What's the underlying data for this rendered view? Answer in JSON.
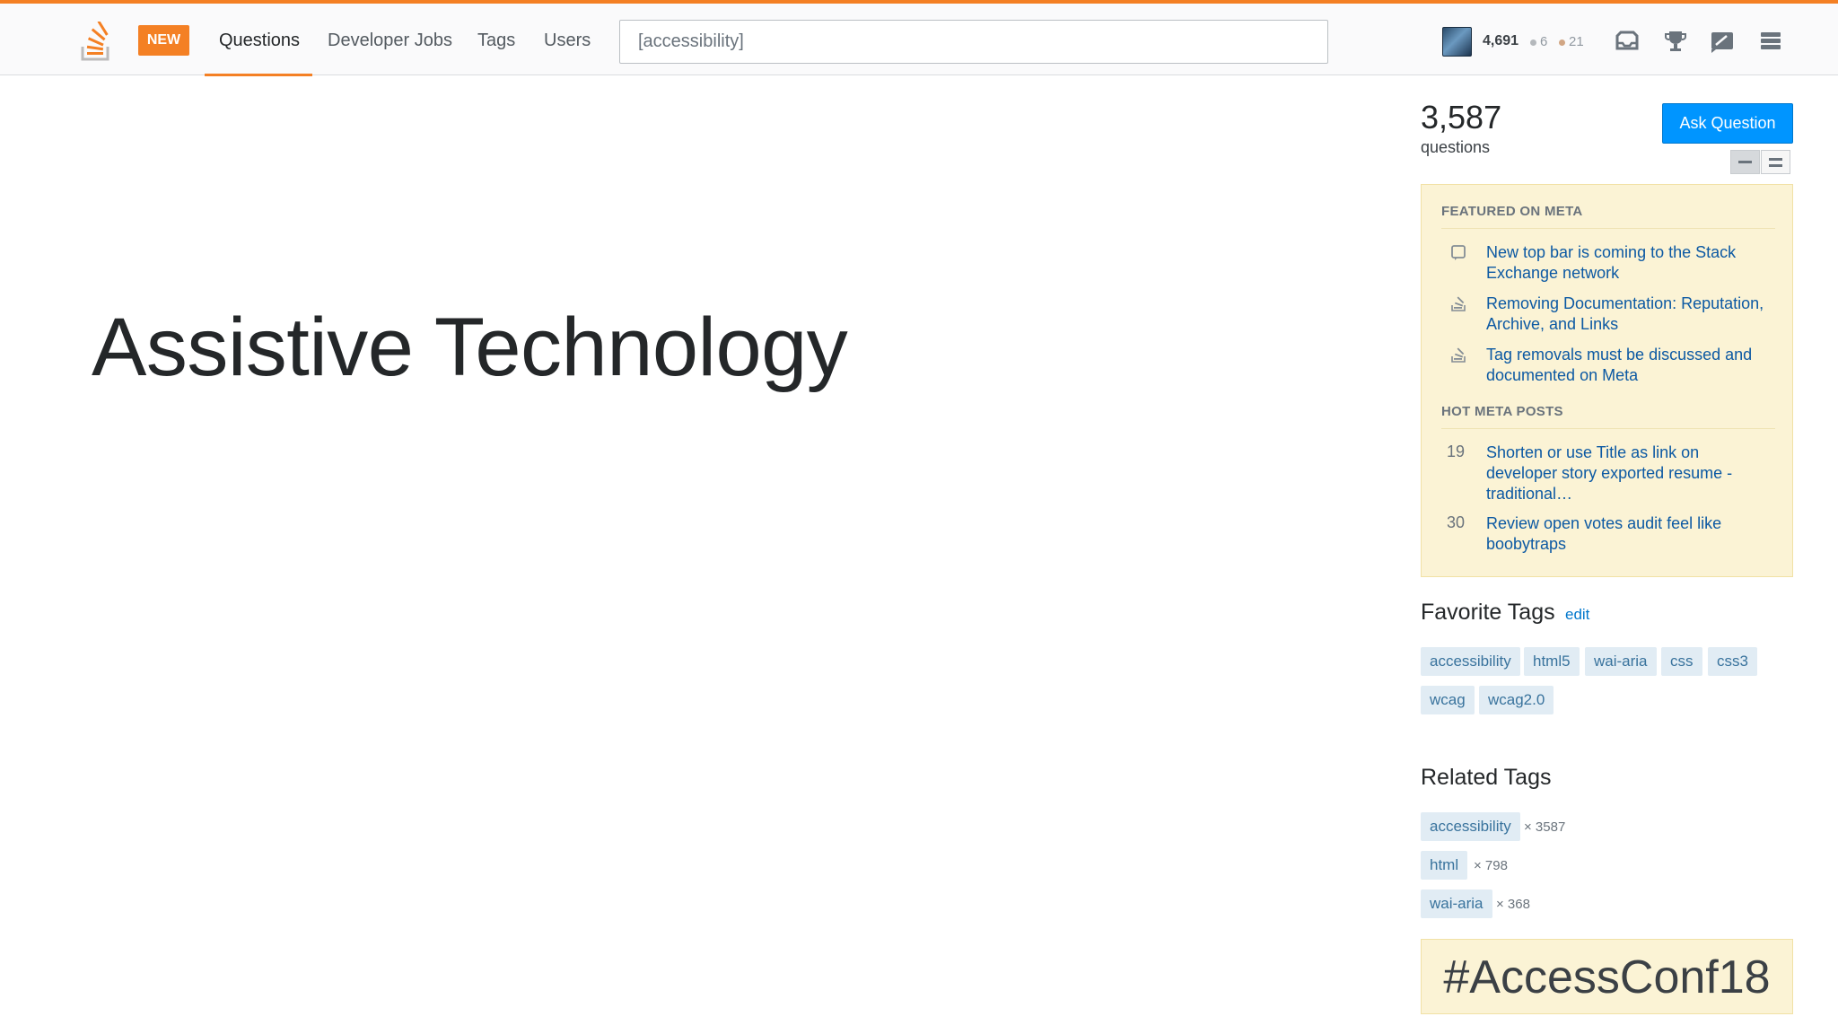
{
  "topbar": {
    "new_badge": "NEW",
    "nav": {
      "questions": "Questions",
      "jobs": "Developer Jobs",
      "tags": "Tags",
      "users": "Users"
    },
    "search_value": "[accessibility]",
    "reputation": "4,691",
    "silver_badges": "6",
    "bronze_badges": "21",
    "accent_color": "#f48024",
    "icons": [
      "stackoverflow-logo-icon",
      "inbox-icon",
      "trophy-icon",
      "review-icon",
      "stackexchange-menu-icon"
    ]
  },
  "slide": {
    "title": "Assistive Technology"
  },
  "sidebar": {
    "question_count": "3,587",
    "question_label": "questions",
    "ask_button": "Ask Question",
    "featured_header": "FEATURED ON META",
    "featured": [
      {
        "line1": "New top bar is coming to the Stack",
        "line2": "Exchange network",
        "icon": "meta-square-icon"
      },
      {
        "line1": "Removing Documentation: Reputation,",
        "line2": "Archive, and Links",
        "icon": "stack-icon"
      },
      {
        "line1": "Tag removals must be discussed and",
        "line2": "documented on Meta",
        "icon": "stack-icon"
      }
    ],
    "hot_header": "HOT META POSTS",
    "hot": [
      {
        "votes": "19",
        "line1": "Shorten or use Title as link on",
        "line2": "developer story exported resume -",
        "line3": "traditional…"
      },
      {
        "votes": "30",
        "line1": "Review open votes audit feel like",
        "line2": "boobytraps"
      }
    ],
    "favorite_title": "Favorite Tags",
    "favorite_edit": "edit",
    "favorite_tags": [
      "accessibility",
      "html5",
      "wai-aria",
      "css",
      "css3",
      "wcag",
      "wcag2.0"
    ],
    "related_title": "Related Tags",
    "related_tags": [
      {
        "name": "accessibility",
        "count": "× 3587"
      },
      {
        "name": "html",
        "count": "× 798"
      },
      {
        "name": "wai-aria",
        "count": "× 368"
      }
    ],
    "hashtag": "#AccessConf18"
  }
}
